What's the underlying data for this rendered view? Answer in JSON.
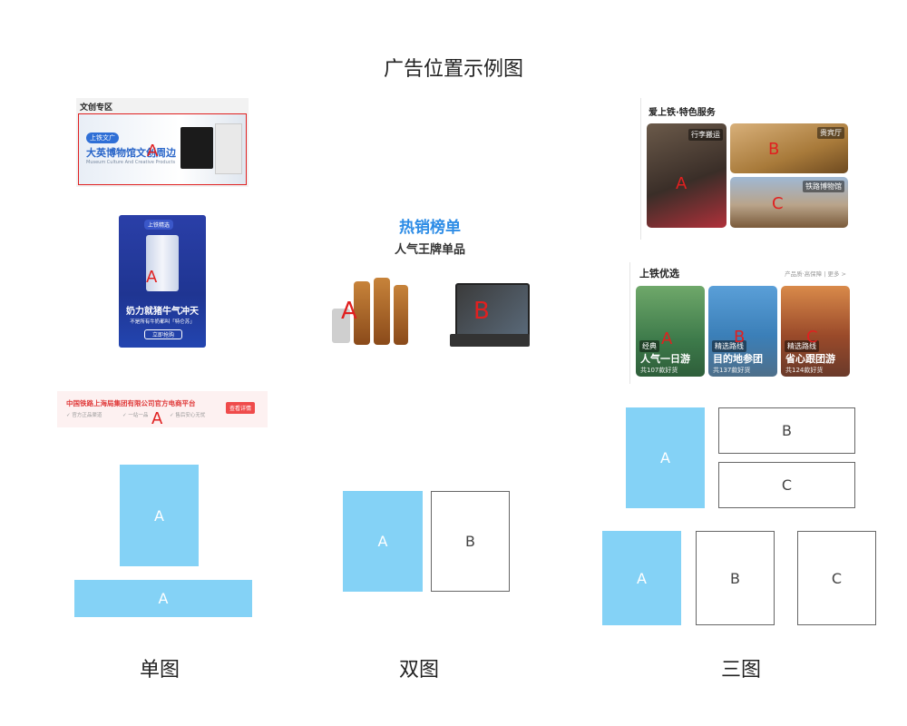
{
  "page": {
    "title": "广告位置示例图"
  },
  "captions": {
    "single": "单图",
    "double": "双图",
    "triple": "三图"
  },
  "markers": {
    "a": "A",
    "b": "B",
    "c": "C"
  },
  "example_wenchuang": {
    "header": "文创专区",
    "badge": "上铁文广",
    "headline": "大英博物馆文创周边",
    "subline": "Museum Culture And Creative Products"
  },
  "example_milk": {
    "badge": "上铁精选",
    "headline": "奶力就猪牛气冲天",
    "subline": "不是所有牛奶都叫「特仑苏」",
    "button": "立即抢购"
  },
  "example_banner": {
    "text": "中国铁路上海局集团有限公司官方电商平台",
    "features": [
      "✓ 官方正品渠道",
      "✓ 一站一品",
      "✓ 售后安心无忧"
    ],
    "button": "查看详情"
  },
  "example_hot": {
    "title": "热销榜单",
    "subtitle": "人气王牌单品"
  },
  "example_service": {
    "header": "爱上铁·特色服务",
    "tag_luggage": "行李搬运",
    "tag_vip": "贵宾厅",
    "tag_museum": "铁路博物馆"
  },
  "example_select": {
    "header": "上铁优选",
    "right": "产品质·高保障 | 更多 >",
    "cards": [
      {
        "tag": "经典",
        "title": "人气一日游",
        "sub": "共107款好货"
      },
      {
        "tag": "精选路线",
        "title": "目的地参团",
        "sub": "共137款好货"
      },
      {
        "tag": "精选路线",
        "title": "省心跟团游",
        "sub": "共124款好货"
      }
    ]
  },
  "colors": {
    "accent_blue": "#84d2f6",
    "marker_red": "#e02020"
  }
}
